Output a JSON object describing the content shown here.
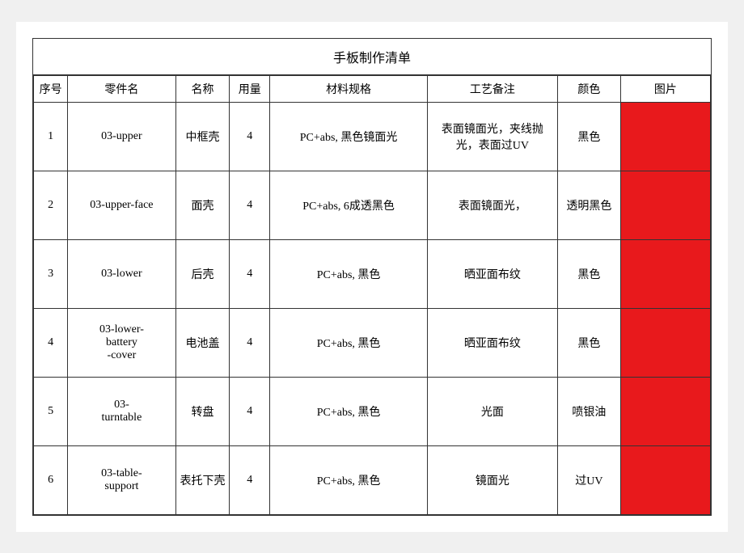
{
  "title": "手板制作清单",
  "headers": {
    "seq": "序号",
    "part_code": "零件名",
    "name": "名称",
    "qty": "用量",
    "spec": "材料规格",
    "craft": "工艺备注",
    "color": "颜色",
    "image": "图片"
  },
  "rows": [
    {
      "seq": "1",
      "part_code": "03-upper",
      "name": "中框壳",
      "qty": "4",
      "spec": "PC+abs, 黑色镜面光",
      "craft": "表面镜面光，夹线抛光，表面过UV",
      "color": "黑色"
    },
    {
      "seq": "2",
      "part_code": "03-upper-face",
      "name": "面壳",
      "qty": "4",
      "spec": "PC+abs, 6成透黑色",
      "craft": "表面镜面光，",
      "color": "透明黑色"
    },
    {
      "seq": "3",
      "part_code": "03-lower",
      "name": "后壳",
      "qty": "4",
      "spec": "PC+abs, 黑色",
      "craft": "晒亚面布纹",
      "color": "黑色"
    },
    {
      "seq": "4",
      "part_code": "03-lower-battery-cover",
      "name": "电池盖",
      "qty": "4",
      "spec": "PC+abs, 黑色",
      "craft": "晒亚面布纹",
      "color": "黑色"
    },
    {
      "seq": "5",
      "part_code": "03-turntable",
      "name": "转盘",
      "qty": "4",
      "spec": "PC+abs, 黑色",
      "craft": "光面",
      "color": "喷银油"
    },
    {
      "seq": "6",
      "part_code": "03-table-support",
      "name": "表托下壳",
      "qty": "4",
      "spec": "PC+abs, 黑色",
      "craft": "镜面光",
      "color": "过UV"
    }
  ]
}
